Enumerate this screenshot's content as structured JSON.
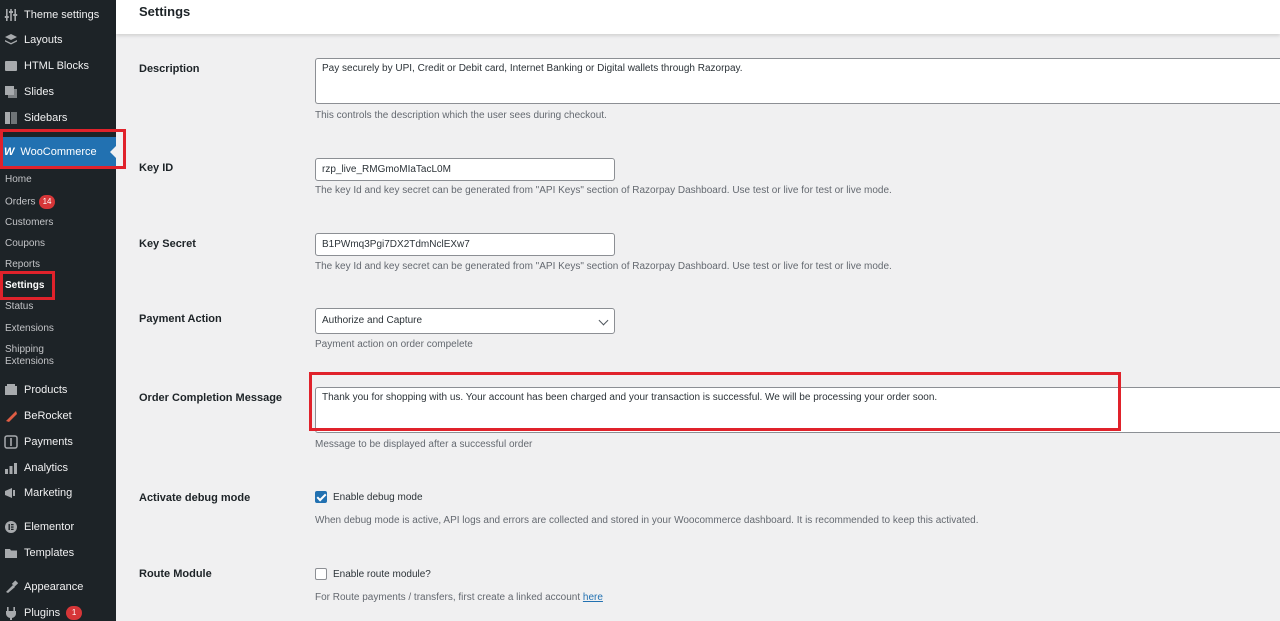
{
  "sidebar": {
    "items_top": [
      {
        "label": "Theme settings",
        "icon": "sliders-icon"
      },
      {
        "label": "Layouts",
        "icon": "layers-icon"
      },
      {
        "label": "HTML Blocks",
        "icon": "html-blocks-icon"
      },
      {
        "label": "Slides",
        "icon": "slides-icon"
      },
      {
        "label": "Sidebars",
        "icon": "sidebars-icon"
      }
    ],
    "woocommerce": {
      "label": "WooCommerce",
      "icon": "woocommerce-icon"
    },
    "submenu": [
      {
        "label": "Home"
      },
      {
        "label": "Orders",
        "badge": "14"
      },
      {
        "label": "Customers"
      },
      {
        "label": "Coupons"
      },
      {
        "label": "Reports"
      },
      {
        "label": "Settings"
      },
      {
        "label": "Status"
      },
      {
        "label": "Extensions"
      },
      {
        "label_line1": "Shipping",
        "label_line2": "Extensions"
      }
    ],
    "items_bottom": [
      {
        "label": "Products",
        "icon": "products-icon"
      },
      {
        "label": "BeRocket",
        "icon": "berocket-icon"
      },
      {
        "label": "Payments",
        "icon": "payments-icon"
      },
      {
        "label": "Analytics",
        "icon": "analytics-icon"
      },
      {
        "label": "Marketing",
        "icon": "marketing-icon"
      },
      {
        "label": "Elementor",
        "icon": "elementor-icon"
      },
      {
        "label": "Templates",
        "icon": "templates-icon"
      },
      {
        "label": "Appearance",
        "icon": "appearance-icon"
      },
      {
        "label": "Plugins",
        "icon": "plugins-icon",
        "badge": "1"
      }
    ]
  },
  "header": {
    "title": "Settings"
  },
  "form": {
    "description": {
      "label": "Description",
      "value": "Pay securely by UPI, Credit or Debit card, Internet Banking or Digital wallets through Razorpay.",
      "help": "This controls the description which the user sees during checkout."
    },
    "key_id": {
      "label": "Key ID",
      "value": "rzp_live_RMGmoMIaTacL0M",
      "help": "The key Id and key secret can be generated from \"API Keys\" section of Razorpay Dashboard. Use test or live for test or live mode."
    },
    "key_secret": {
      "label": "Key Secret",
      "value": "B1PWmq3Pgi7DX2TdmNclEXw7",
      "help": "The key Id and key secret can be generated from \"API Keys\" section of Razorpay Dashboard. Use test or live for test or live mode."
    },
    "payment_action": {
      "label": "Payment Action",
      "value": "Authorize and Capture",
      "help": "Payment action on order compelete"
    },
    "order_completion": {
      "label": "Order Completion Message",
      "value": "Thank you for shopping with us. Your account has been charged and your transaction is successful. We will be processing your order soon.",
      "help": "Message to be displayed after a successful order"
    },
    "debug_mode": {
      "label": "Activate debug mode",
      "checkbox_label": "Enable debug mode",
      "checked": true,
      "help": "When debug mode is active, API logs and errors are collected and stored in your Woocommerce dashboard. It is recommended to keep this activated."
    },
    "route_module": {
      "label": "Route Module",
      "checkbox_label": "Enable route module?",
      "checked": false,
      "help_prefix": "For Route payments / transfers, first create a linked account ",
      "help_link": "here"
    }
  },
  "colors": {
    "sidebar_bg": "#1d2327",
    "accent": "#2271b1",
    "highlight_box": "#e0222b",
    "badge": "#d63638"
  }
}
